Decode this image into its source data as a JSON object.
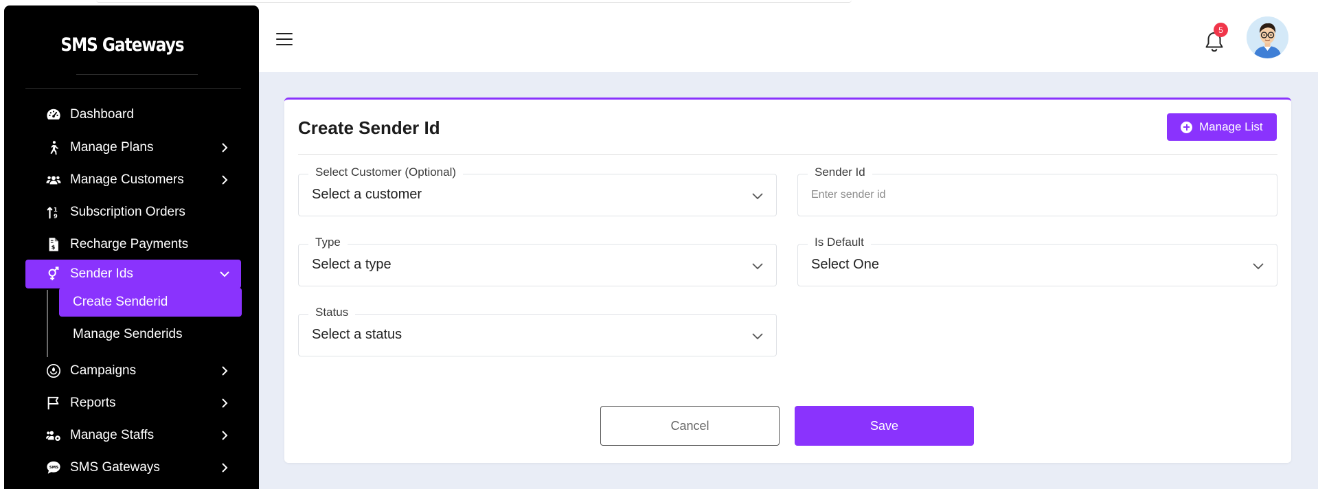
{
  "brand": {
    "title": "SMS Gateways"
  },
  "sidebar": {
    "items": [
      {
        "label": "Dashboard",
        "icon": "gauge-icon",
        "has_chevron": false
      },
      {
        "label": "Manage Plans",
        "icon": "person-walking-icon",
        "has_chevron": true
      },
      {
        "label": "Manage Customers",
        "icon": "users-icon",
        "has_chevron": true
      },
      {
        "label": "Subscription Orders",
        "icon": "sort-arrows-icon",
        "has_chevron": false
      },
      {
        "label": "Recharge Payments",
        "icon": "invoice-dollar-icon",
        "has_chevron": false
      },
      {
        "label": "Sender Ids",
        "icon": "venus-mars-icon",
        "has_chevron": true,
        "active": true,
        "expanded": true
      },
      {
        "label": "Campaigns",
        "icon": "campaign-icon",
        "has_chevron": true
      },
      {
        "label": "Reports",
        "icon": "flag-icon",
        "has_chevron": true
      },
      {
        "label": "Manage Staffs",
        "icon": "users-gear-icon",
        "has_chevron": true
      },
      {
        "label": "SMS Gateways",
        "icon": "sms-bubble-icon",
        "has_chevron": true
      }
    ],
    "sub_items": [
      {
        "label": "Create Senderid",
        "active": true
      },
      {
        "label": "Manage Senderids",
        "active": false
      }
    ]
  },
  "header": {
    "notification_count": "5",
    "icons": [
      "hamburger-menu-icon",
      "bell-icon",
      "user-avatar"
    ]
  },
  "form": {
    "title": "Create Sender Id",
    "manage_button_label": "Manage List",
    "fields": {
      "customer": {
        "label": "Select Customer (Optional)",
        "value": "Select a customer"
      },
      "sender_id": {
        "label": "Sender Id",
        "placeholder": "Enter sender id"
      },
      "type": {
        "label": "Type",
        "value": "Select a type"
      },
      "is_default": {
        "label": "Is Default",
        "value": "Select One"
      },
      "status": {
        "label": "Status",
        "value": "Select a status"
      }
    },
    "cancel_label": "Cancel",
    "save_label": "Save"
  },
  "colors": {
    "accent": "#8a33fd",
    "sidebar_bg": "#000000",
    "content_bg": "#e9edf6",
    "badge": "#f0364a"
  }
}
